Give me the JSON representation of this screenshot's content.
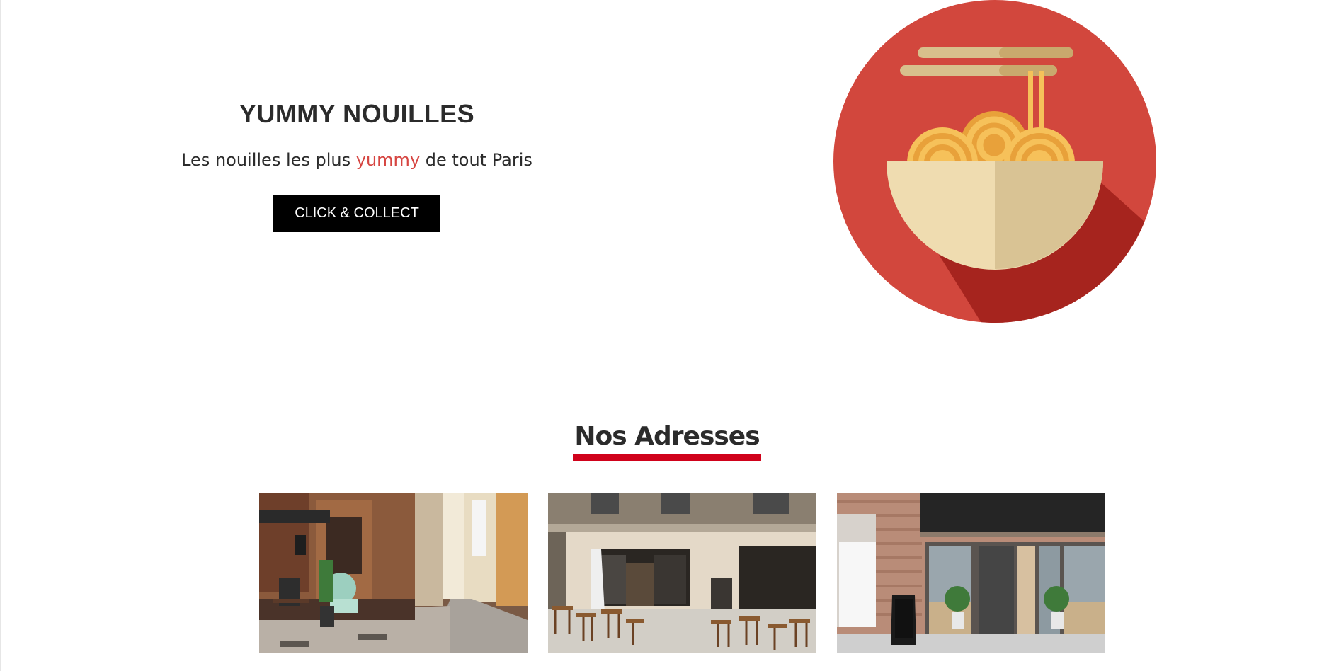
{
  "hero": {
    "title": "YUMMY NOUILLES",
    "tagline_before": "Les nouilles les plus ",
    "tagline_accent": "yummy",
    "tagline_after": " de tout Paris",
    "cta_label": "CLICK & COLLECT"
  },
  "addresses": {
    "title": "Nos Adresses",
    "photos": [
      {
        "icon": "street-cafe-photo"
      },
      {
        "icon": "terrace-restaurant-photo"
      },
      {
        "icon": "shopfront-photo"
      }
    ]
  },
  "colors": {
    "accent": "#d64541",
    "underline": "#d0021b",
    "button_bg": "#000000",
    "text": "#2b2b2b"
  }
}
